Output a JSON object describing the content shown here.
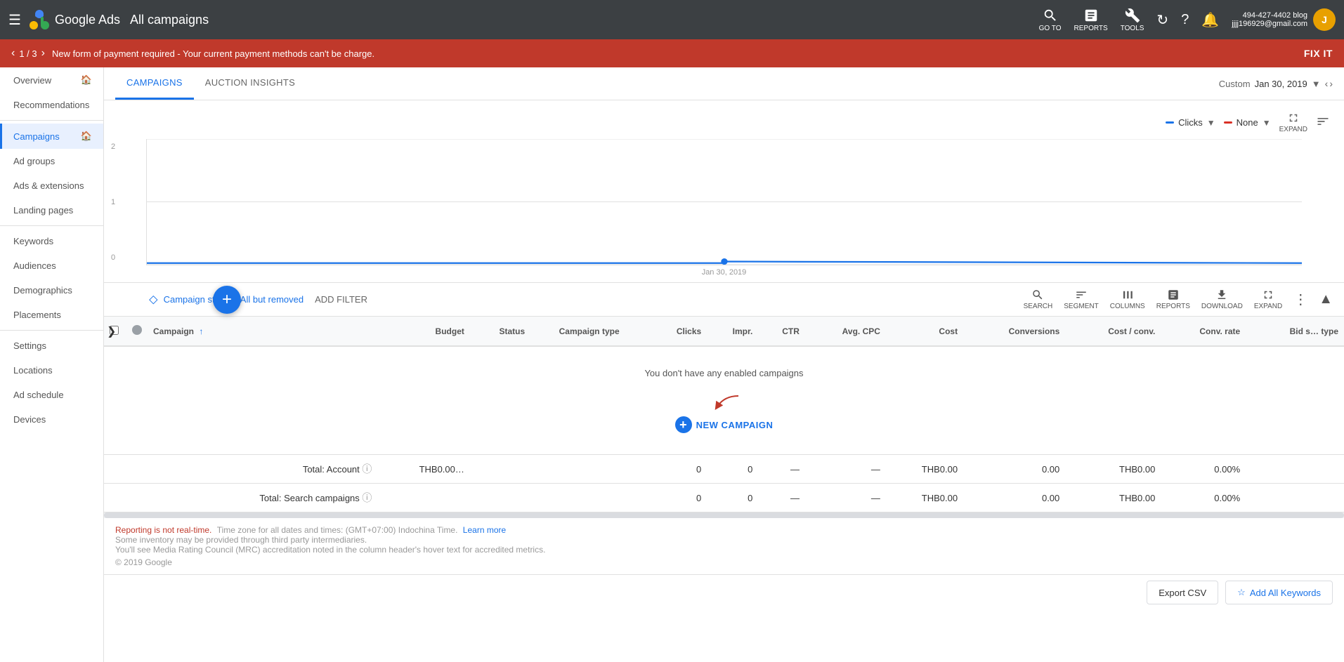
{
  "topNav": {
    "hamburger": "☰",
    "appName": "Google Ads",
    "pageTitle": "All campaigns",
    "icons": [
      {
        "name": "go-to",
        "label": "GO TO"
      },
      {
        "name": "reports",
        "label": "REPORTS"
      },
      {
        "name": "tools",
        "label": "TOOLS"
      }
    ],
    "refreshTitle": "Refresh",
    "helpTitle": "Help",
    "notifTitle": "Notifications",
    "userEmail": "jjjj196929@gmail.com",
    "userAvatarLetter": "J"
  },
  "alertBar": {
    "counter": "1 / 3",
    "message": "New form of payment required - Your current payment methods can't be charge.",
    "fixItLabel": "FIX IT"
  },
  "sidebar": {
    "items": [
      {
        "label": "Overview",
        "active": false,
        "hasHome": true
      },
      {
        "label": "Recommendations",
        "active": false
      },
      {
        "label": "Campaigns",
        "active": true,
        "hasHome": true
      },
      {
        "label": "Ad groups",
        "active": false
      },
      {
        "label": "Ads & extensions",
        "active": false
      },
      {
        "label": "Landing pages",
        "active": false
      },
      {
        "label": "Keywords",
        "active": false
      },
      {
        "label": "Audiences",
        "active": false
      },
      {
        "label": "Demographics",
        "active": false
      },
      {
        "label": "Placements",
        "active": false
      },
      {
        "label": "Settings",
        "active": false
      },
      {
        "label": "Locations",
        "active": false
      },
      {
        "label": "Ad schedule",
        "active": false
      },
      {
        "label": "Devices",
        "active": false
      }
    ]
  },
  "tabs": {
    "items": [
      {
        "label": "CAMPAIGNS",
        "active": true
      },
      {
        "label": "AUCTION INSIGHTS",
        "active": false
      }
    ]
  },
  "dateRange": {
    "preset": "Custom",
    "date": "Jan 30, 2019"
  },
  "chart": {
    "metrics": [
      {
        "label": "Clicks",
        "type": "blue"
      },
      {
        "label": "None",
        "type": "red"
      }
    ],
    "expandLabel": "EXPAND",
    "yLabels": [
      "2",
      "1",
      "0"
    ],
    "xLabel": "Jan 30, 2019"
  },
  "toolbar": {
    "filterIcon": "▼",
    "filterText": "Campaign status:",
    "filterValue": "All but removed",
    "addFilterLabel": "ADD FILTER",
    "buttons": [
      {
        "name": "search",
        "label": "SEARCH"
      },
      {
        "name": "segment",
        "label": "SEGMENT"
      },
      {
        "name": "columns",
        "label": "COLUMNS"
      },
      {
        "name": "reports",
        "label": "REPORTS"
      },
      {
        "name": "download",
        "label": "DOWNLOAD"
      },
      {
        "name": "expand",
        "label": "EXPAND"
      },
      {
        "name": "more",
        "label": "MORE"
      }
    ]
  },
  "fab": {
    "label": "+"
  },
  "table": {
    "columns": [
      {
        "key": "campaign",
        "label": "Campaign",
        "sortable": true
      },
      {
        "key": "budget",
        "label": "Budget"
      },
      {
        "key": "status",
        "label": "Status"
      },
      {
        "key": "campaignType",
        "label": "Campaign type"
      },
      {
        "key": "clicks",
        "label": "Clicks"
      },
      {
        "key": "impr",
        "label": "Impr."
      },
      {
        "key": "ctr",
        "label": "CTR"
      },
      {
        "key": "avgCpc",
        "label": "Avg. CPC"
      },
      {
        "key": "cost",
        "label": "Cost"
      },
      {
        "key": "conversions",
        "label": "Conversions"
      },
      {
        "key": "costConv",
        "label": "Cost / conv."
      },
      {
        "key": "convRate",
        "label": "Conv. rate"
      },
      {
        "key": "bidType",
        "label": "Bid s… type"
      }
    ],
    "emptyMessage": "You don't have any enabled campaigns",
    "newCampaignLabel": "NEW CAMPAIGN",
    "totals": [
      {
        "label": "Total: Account",
        "budget": "THB0.00…",
        "status": "",
        "campaignType": "",
        "clicks": "0",
        "impr": "0",
        "ctr": "—",
        "avgCpc": "—",
        "cost": "THB0.00",
        "conversions": "0.00",
        "costConv": "THB0.00",
        "convRate": "0.00%",
        "bidType": ""
      },
      {
        "label": "Total: Search campaigns",
        "budget": "",
        "status": "",
        "campaignType": "",
        "clicks": "0",
        "impr": "0",
        "ctr": "—",
        "avgCpc": "—",
        "cost": "THB0.00",
        "conversions": "0.00",
        "costConv": "THB0.00",
        "convRate": "0.00%",
        "bidType": ""
      }
    ]
  },
  "footer": {
    "realtimeNote": "Reporting is not real-time.",
    "timezoneText": "Time zone for all dates and times: (GMT+07:00) Indochina Time.",
    "learnMoreLabel": "Learn more",
    "inventoryNote": "Some inventory may be provided through third party intermediaries.",
    "mrcNote": "You'll see Media Rating Council (MRC) accreditation noted in the column header's hover text for accredited metrics.",
    "copyright": "© 2019 Google"
  },
  "bottomBar": {
    "exportCsvLabel": "Export CSV",
    "addKeywordsLabel": "Add All Keywords"
  }
}
